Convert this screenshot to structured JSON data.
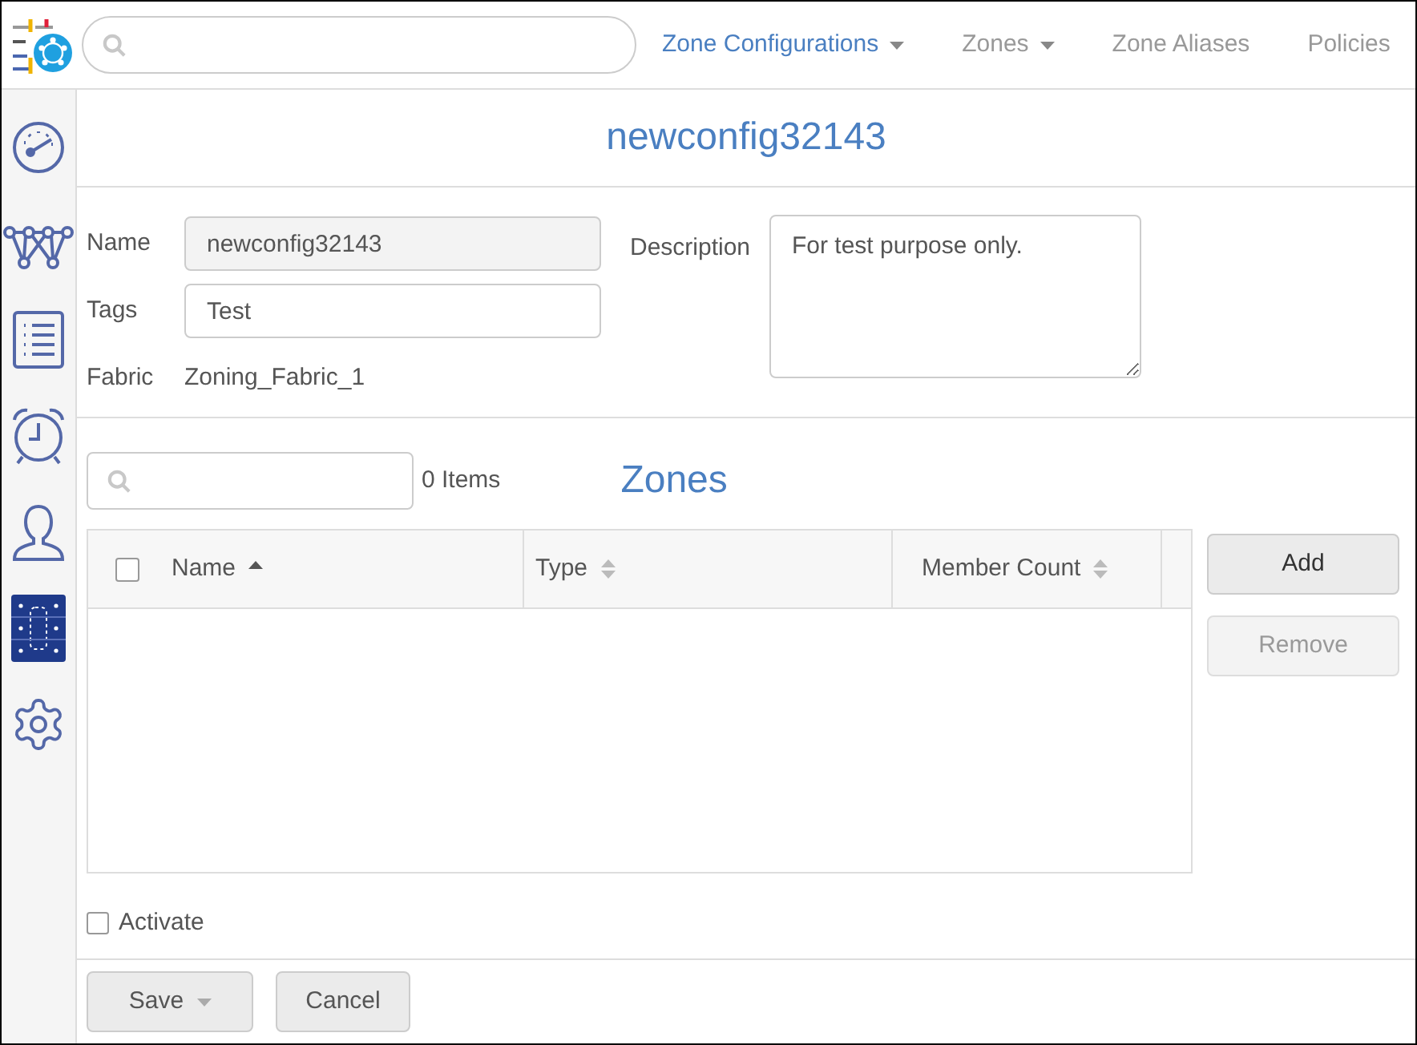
{
  "nav": [
    {
      "label": "Zone Configurations",
      "selected": true,
      "dropdown": true
    },
    {
      "label": "Zones",
      "selected": false,
      "dropdown": true
    },
    {
      "label": "Zone Aliases",
      "selected": false,
      "dropdown": false
    },
    {
      "label": "Policies",
      "selected": false,
      "dropdown": false
    }
  ],
  "sidebar": [
    {
      "kind": "gauge"
    },
    {
      "kind": "network"
    },
    {
      "kind": "list"
    },
    {
      "kind": "alarm"
    },
    {
      "kind": "user"
    },
    {
      "kind": "chip"
    },
    {
      "kind": "gear"
    }
  ],
  "title": "newconfig32143",
  "form": {
    "name_label": "Name",
    "name_value": "newconfig32143",
    "tags_label": "Tags",
    "tags_value": "Test",
    "fabric_label": "Fabric",
    "fabric_value": "Zoning_Fabric_1",
    "description_label": "Description",
    "description_value": "For test purpose only."
  },
  "zones": {
    "count": "0 Items",
    "title": "Zones",
    "select_all_checked": false,
    "columns": [
      {
        "label": "Name",
        "sorted": true
      },
      {
        "label": "Type",
        "sorted": false
      },
      {
        "label": "Member Count",
        "sorted": false
      }
    ],
    "buttons": [
      {
        "label": "Add",
        "disabled": false
      },
      {
        "label": "Remove",
        "disabled": true
      }
    ]
  },
  "activate": {
    "label": "Activate",
    "checked": false
  },
  "footer": {
    "save": "Save",
    "cancel": "Cancel"
  }
}
